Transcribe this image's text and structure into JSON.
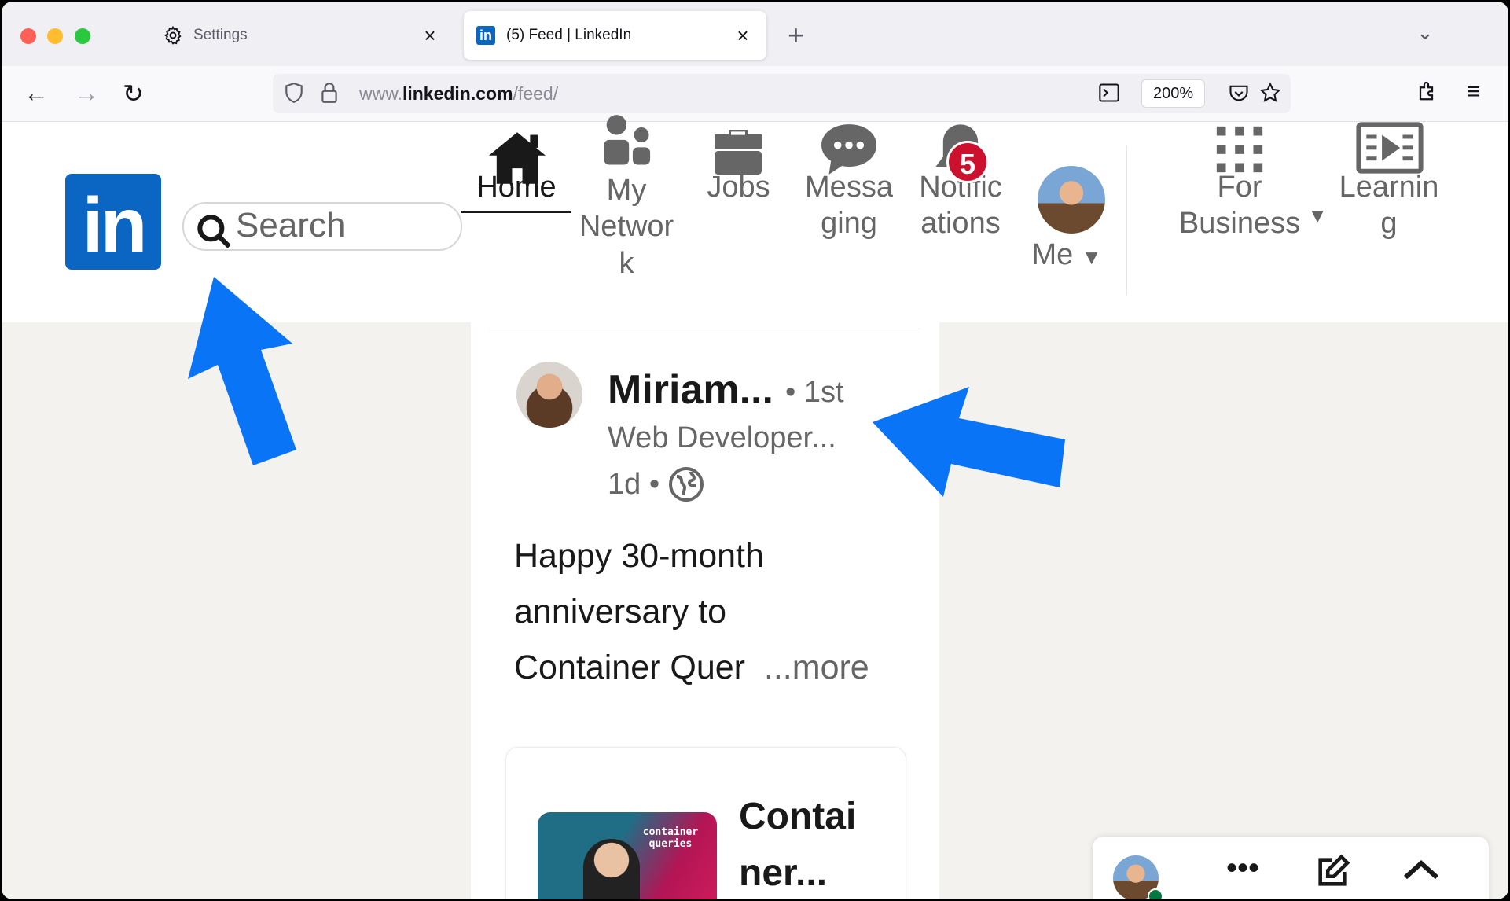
{
  "browser": {
    "tabs": [
      {
        "title": "Settings",
        "icon": "gear-icon"
      },
      {
        "title": "(5) Feed | LinkedIn",
        "icon": "linkedin-icon"
      }
    ],
    "url_prefix": "www.",
    "url_domain": "linkedin.com",
    "url_path": "/feed/",
    "zoom": "200%"
  },
  "linkedin": {
    "logo": "in",
    "search_placeholder": "Search",
    "nav": {
      "home": "Home",
      "network_line1": "My",
      "network_line2": "Networ",
      "network_line3": "k",
      "jobs": "Jobs",
      "messaging_line1": "Messa",
      "messaging_line2": "ging",
      "notifications_line1": "Notific",
      "notifications_line2": "ations",
      "notifications_count": "5",
      "me": "Me",
      "business_line1": "For",
      "business_line2": "Business",
      "learning_line1": "Learnin",
      "learning_line2": "g"
    }
  },
  "post": {
    "author": "Miriam...",
    "degree": "• 1st",
    "headline": "Web Developer...",
    "time": "1d •",
    "text_line1": "Happy 30-month",
    "text_line2": "anniversary to",
    "text_line3": "Container Quer",
    "more": "...more",
    "article_title_line1": "Contai",
    "article_title_line2": "ner...",
    "thumb_text": "container queries"
  },
  "colors": {
    "linkedin_blue": "#0a66c2",
    "badge_red": "#cb112d",
    "annotation_blue": "#0a74f6"
  }
}
